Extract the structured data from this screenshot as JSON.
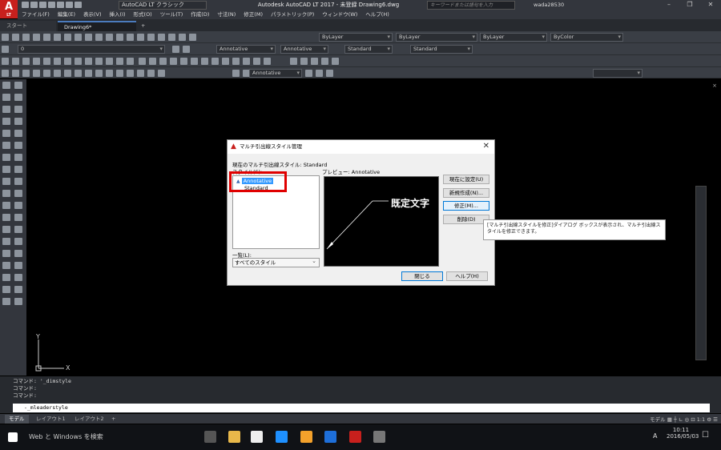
{
  "app": {
    "logo_text": "A",
    "logo_sub": "LT",
    "workspace": "AutoCAD LT クラシック",
    "title": "Autodesk AutoCAD LT 2017 - 未登録   Drawing6.dwg",
    "search_placeholder": "キーワードまたは語句を入力",
    "user": "wada28530"
  },
  "menu": [
    "ファイル(F)",
    "編集(E)",
    "表示(V)",
    "挿入(I)",
    "形式(O)",
    "ツール(T)",
    "作成(D)",
    "寸法(N)",
    "修正(M)",
    "パラメトリック(P)",
    "ウィンドウ(W)",
    "ヘルプ(H)"
  ],
  "tabs": {
    "start": "スタート",
    "drawing": "Drawing6*",
    "add": "+"
  },
  "toolbars": {
    "layer_color": "ByLayer",
    "linetype": "ByLayer",
    "lineweight": "ByLayer",
    "plotstyle": "ByColor",
    "layer_name": "0",
    "text_style1": "Annotative",
    "text_style2": "Annotative",
    "text_style3": "Standard",
    "text_style4": "Standard",
    "mleader_style": "Annotative"
  },
  "dialog": {
    "title": "マルチ引出線スタイル管理",
    "current_label": "現在のマルチ引出線スタイル: Standard",
    "styles_label": "スタイル(S):",
    "preview_label": "プレビュー: Annotative",
    "styles": [
      "Annotative",
      "Standard"
    ],
    "preview_text": "既定文字",
    "list_label": "一覧(L):",
    "list_value": "すべてのスタイル",
    "buttons": {
      "set_current": "現在に設定(U)",
      "new": "新規作成(N)...",
      "modify": "修正(M)...",
      "delete": "削除(D)",
      "close": "閉じる",
      "help": "ヘルプ(H)"
    }
  },
  "tooltip": "[マルチ引出線スタイルを修正]ダイアログ ボックスが表示され、マルチ引出線スタイルを修正できます。",
  "ucs": {
    "y": "Y",
    "x": "X"
  },
  "command": {
    "history": [
      "コマンド: '_dimstyle",
      "コマンド:",
      "コマンド:"
    ],
    "current": "-_mleaderstyle"
  },
  "layout_tabs": [
    "モデル",
    "レイアウト1",
    "レイアウト2",
    "+"
  ],
  "status": {
    "model": "モデル",
    "scale": "1:1"
  },
  "taskbar": {
    "search": "Web と Windows を検索",
    "time": "10:11",
    "date": "2016/05/03",
    "ime": "A"
  },
  "colors": {
    "accent_red": "#e00000",
    "autocad_red": "#c8201d"
  }
}
